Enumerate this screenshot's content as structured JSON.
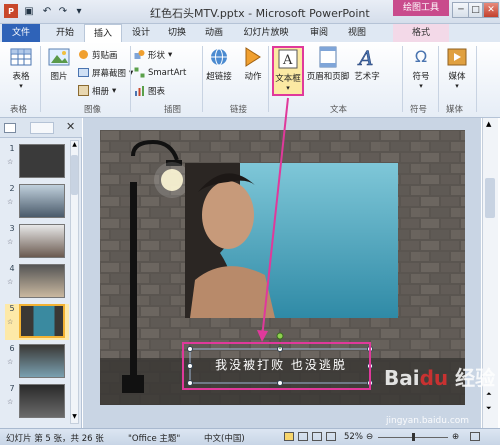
{
  "window": {
    "title": "红色石头MTV.pptx - Microsoft PowerPoint",
    "context_tab_group": "绘图工具",
    "buttons": {
      "minimize": "─",
      "maximize": "□",
      "close": "✕"
    }
  },
  "quick_access": [
    "powerpoint-icon",
    "save-icon",
    "undo-icon",
    "redo-icon",
    "customize-icon"
  ],
  "tabs": [
    {
      "label": "文件"
    },
    {
      "label": "开始"
    },
    {
      "label": "插入"
    },
    {
      "label": "设计"
    },
    {
      "label": "切换"
    },
    {
      "label": "动画"
    },
    {
      "label": "幻灯片放映"
    },
    {
      "label": "审阅"
    },
    {
      "label": "视图"
    },
    {
      "label": "格式"
    }
  ],
  "ribbon": {
    "groups": [
      "表格",
      "图像",
      "插图",
      "链接",
      "文本",
      "符号",
      "媒体"
    ],
    "table_btn": "表格",
    "picture_btn": "图片",
    "clipart_btn": "剪贴画",
    "screenshot_btn": "屏幕截图",
    "album_btn": "相册",
    "shapes_btn": "形状",
    "smartart_btn": "SmartArt",
    "chart_btn": "图表",
    "hyperlink_btn": "超链接",
    "action_btn": "动作",
    "textbox_btn": "文本框",
    "header_footer_btn": "页眉和页脚",
    "wordart_btn": "艺术字",
    "symbol_btn": "符号",
    "media_btn": "媒体"
  },
  "thumbnails": [
    "1",
    "2",
    "3",
    "4",
    "5",
    "6",
    "7"
  ],
  "selected_thumbnail": "5",
  "slide": {
    "caption": "我没被打败 也没逃脱"
  },
  "status": {
    "slide_info": "幻灯片 第 5 张，共 26 张",
    "theme": "\"Office 主题\"",
    "language": "中文(中国)",
    "zoom": "52%",
    "watermark": "jingyan.baidu.com"
  },
  "colors": {
    "highlight": "#e0399b",
    "file_tab": "#2f63b8",
    "context_tab": "#c94b8c"
  }
}
